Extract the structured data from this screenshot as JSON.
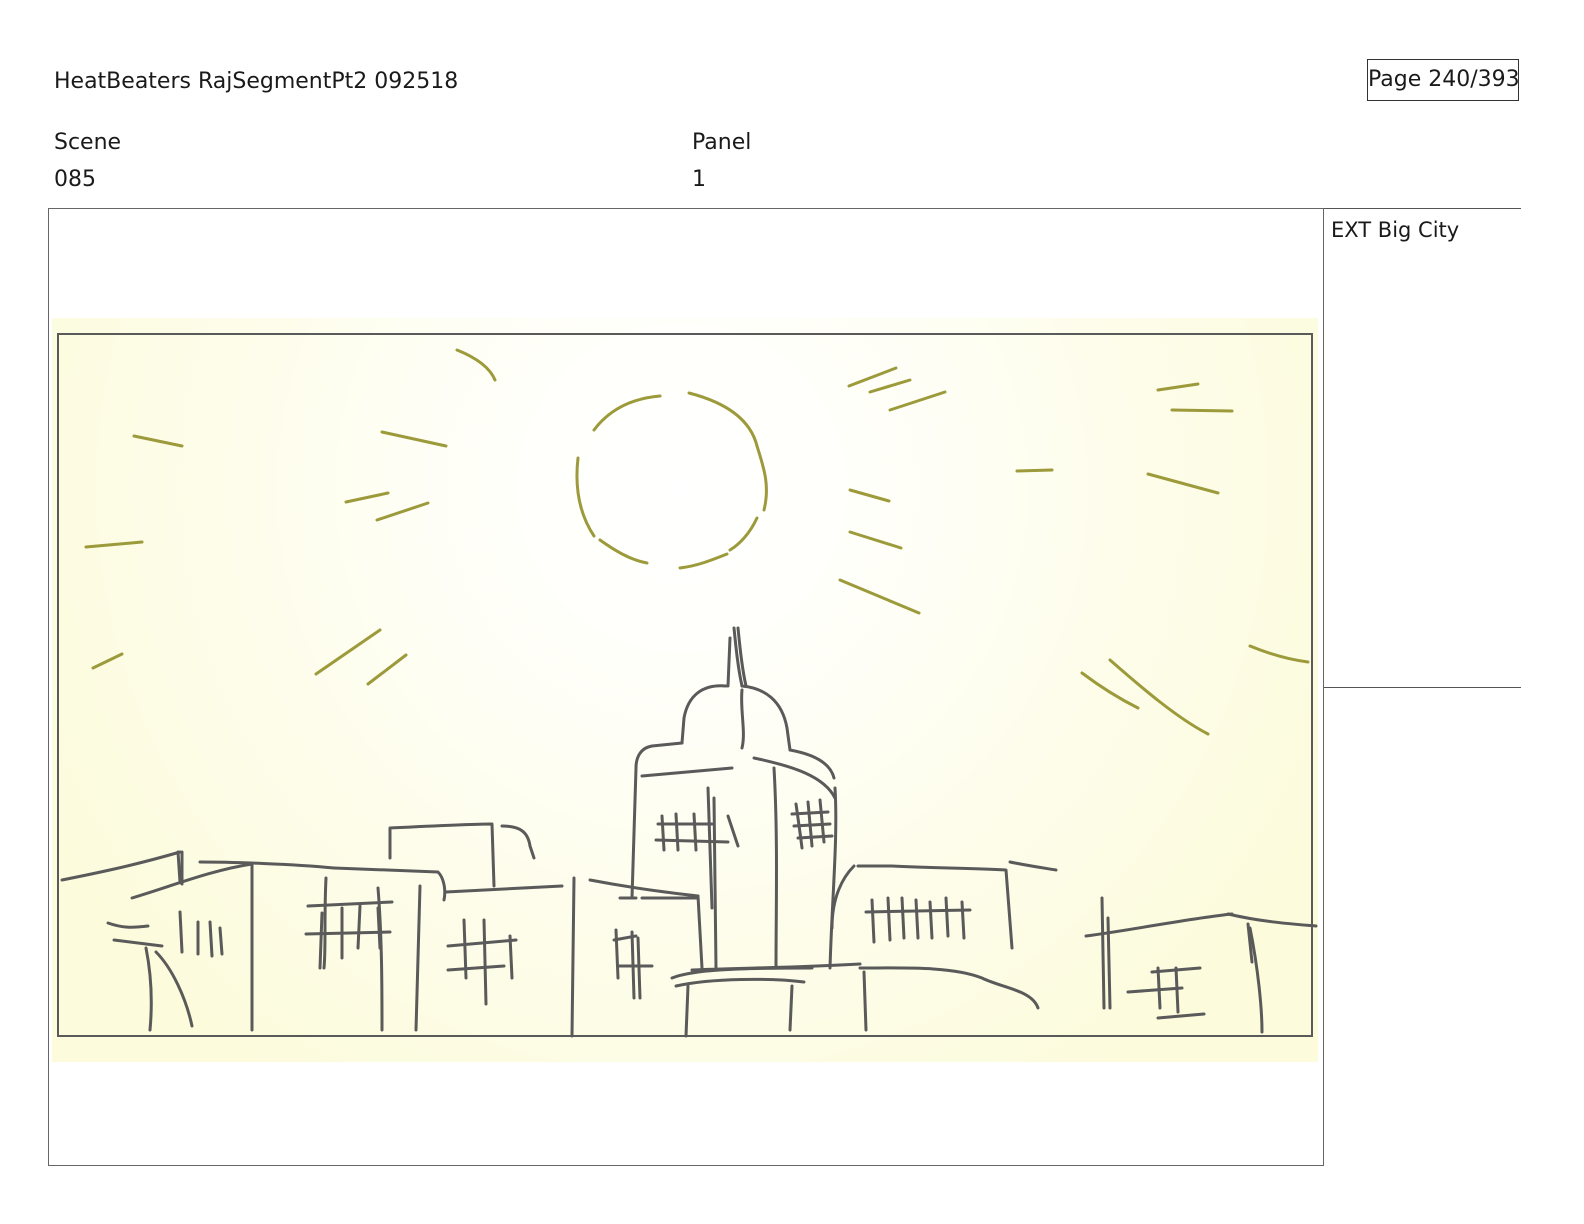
{
  "header": {
    "title": "HeatBeaters RajSegmentPt2 092518",
    "page_indicator": "Page 240/393"
  },
  "meta": {
    "scene_label": "Scene",
    "scene_value": "085",
    "panel_label": "Panel",
    "panel_value": "1"
  },
  "notes": {
    "text": "EXT Big City"
  },
  "colors": {
    "sketch_background": "#fdfce2",
    "sun_stroke": "#9c9a3a",
    "building_stroke": "#5a5a5a"
  }
}
